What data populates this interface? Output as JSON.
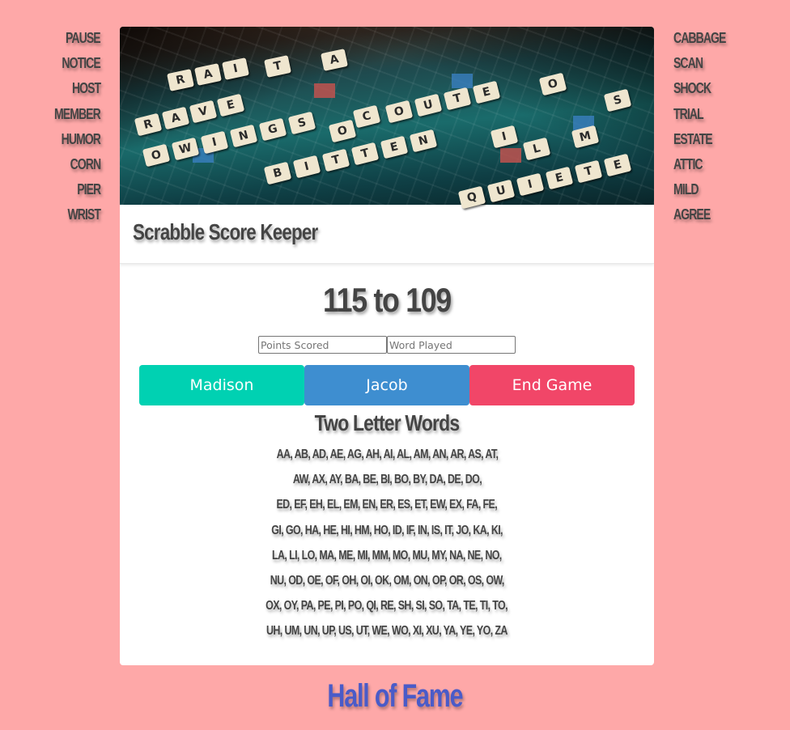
{
  "left_words": [
    "PAUSE",
    "NOTICE",
    "HOST",
    "MEMBER",
    "HUMOR",
    "CORN",
    "PIER",
    "WRIST"
  ],
  "right_words": [
    "CABBAGE",
    "SCAN",
    "SHOCK",
    "TRIAL",
    "ESTATE",
    "ATTIC",
    "MILD",
    "AGREE"
  ],
  "app": {
    "title": "Scrabble Score Keeper"
  },
  "score": {
    "text": "115 to 109"
  },
  "form": {
    "points_placeholder": "Points Scored",
    "word_placeholder": "Word Played"
  },
  "buttons": {
    "player1": "Madison",
    "player2": "Jacob",
    "end_game": "End Game"
  },
  "two_letter": {
    "title": "Two Letter Words",
    "lines": [
      "AA, AB, AD, AE, AG, AH, AI, AL, AM, AN, AR, AS, AT,",
      "AW, AX, AY, BA, BE, BI, BO, BY, DA, DE, DO,",
      "ED, EF, EH, EL, EM, EN, ER, ES, ET, EW, EX, FA, FE,",
      "GI, GO, HA, HE, HI, HM, HO, ID, IF, IN, IS, IT, JO, KA, KI,",
      "LA, LI, LO, MA, ME, MI, MM, MO, MU, MY, NA, NE, NO,",
      "NU, OD, OE, OF, OH, OI, OK, OM, ON, OP, OR, OS, OW,",
      "OX, OY, PA, PE, PI, PO, QI, RE, SH, SI, SO, TA, TE, TI, TO,",
      "UH, UM, UN, UP, US, UT, WE, WO, XI, XU, YA, YE, YO, ZA"
    ]
  },
  "footer": {
    "hall_of_fame": "Hall of Fame"
  },
  "colors": {
    "background": "#fea8a8",
    "teal": "#00d1b2",
    "blue": "#3e8ed0",
    "red": "#f14668",
    "hall_of_fame": "#4a5bc8"
  }
}
